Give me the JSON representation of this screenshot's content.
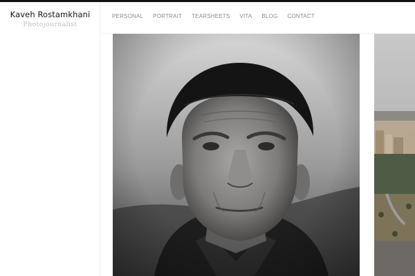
{
  "site": {
    "name": "Kaveh Rostamkhani",
    "tagline": "Photojournalist"
  },
  "nav": {
    "items": [
      {
        "label": "PERSONAL"
      },
      {
        "label": "PORTRAIT"
      },
      {
        "label": "TEARSHEETS"
      },
      {
        "label": "VITA"
      },
      {
        "label": "BLOG"
      },
      {
        "label": "CONTACT"
      }
    ]
  },
  "gallery": {
    "images": [
      {
        "subject": "black-and-white portrait of an elderly man in a dark knit cap"
      },
      {
        "subject": "hazy city view with apartment blocks and hillside trees"
      }
    ]
  },
  "colors": {
    "topbar": "#111111",
    "nav_text": "#8a8a8a",
    "tagline": "#bdbdbd"
  }
}
